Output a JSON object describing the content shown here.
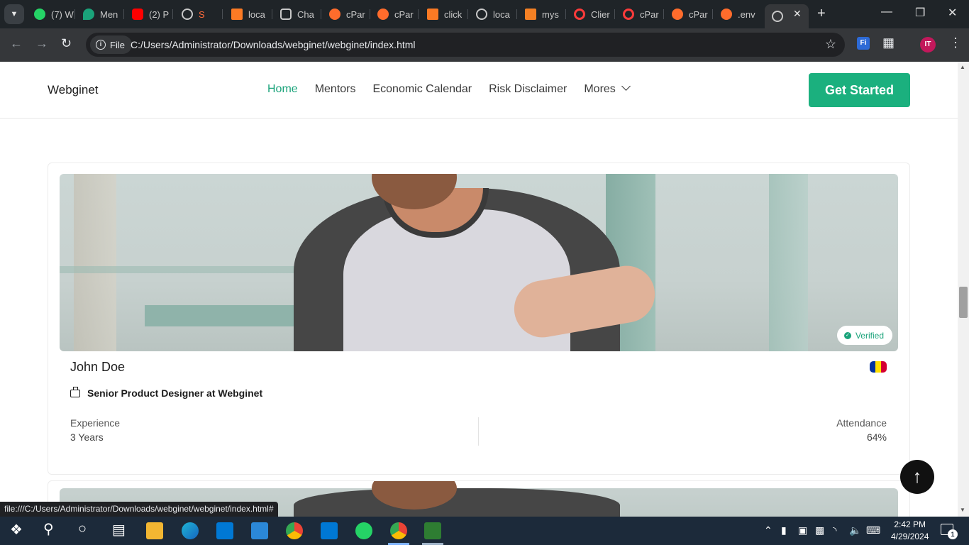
{
  "browser": {
    "tabs": [
      {
        "label": "(7) W",
        "icon": "whatsapp-icon",
        "color": "#25d366"
      },
      {
        "label": "Men",
        "icon": "map-pin-icon",
        "color": "#1aa37a"
      },
      {
        "label": "(2) P",
        "icon": "youtube-icon",
        "color": "#ff0000"
      },
      {
        "label": "S",
        "icon": "globe-icon",
        "color": "#c8c8c8"
      },
      {
        "label": "loca",
        "icon": "xampp-icon",
        "color": "#fb7a24"
      },
      {
        "label": "Cha",
        "icon": "chatgpt-icon",
        "color": "#c8c8c8"
      },
      {
        "label": "cPar",
        "icon": "cpanel-icon",
        "color": "#ff6c2c"
      },
      {
        "label": "cPar",
        "icon": "cpanel-icon",
        "color": "#ff6c2c"
      },
      {
        "label": "click",
        "icon": "xampp-icon",
        "color": "#fb7a24"
      },
      {
        "label": "loca",
        "icon": "globe-icon",
        "color": "#c8c8c8"
      },
      {
        "label": "mys",
        "icon": "stackoverflow-icon",
        "color": "#f48024"
      },
      {
        "label": "Clier",
        "icon": "opera-icon",
        "color": "#ff3b3b"
      },
      {
        "label": "cPar",
        "icon": "opera-icon",
        "color": "#ff3b3b"
      },
      {
        "label": "cPar",
        "icon": "cpanel-icon",
        "color": "#ff6c2c"
      },
      {
        "label": ".env",
        "icon": "cpanel-icon",
        "color": "#ff6c2c"
      }
    ],
    "active_tab_icon": "globe-icon",
    "address": {
      "chip_label": "File",
      "url": "C:/Users/Administrator/Downloads/webginet/webginet/index.html"
    },
    "profile_initials": "IT",
    "extension_label": "Fi",
    "status_url": "file:///C:/Users/Administrator/Downloads/webginet/webginet/index.html#"
  },
  "site": {
    "brand": "Webginet",
    "nav": [
      {
        "label": "Home",
        "active": true
      },
      {
        "label": "Mentors"
      },
      {
        "label": "Economic Calendar"
      },
      {
        "label": "Risk Disclaimer"
      },
      {
        "label": "Mores",
        "dropdown": true
      }
    ],
    "cta": "Get Started",
    "accent_color": "#1bb07e"
  },
  "mentor_card": {
    "name": "John Doe",
    "badge": "Verified",
    "role": "Senior Product Designer at Webginet",
    "experience_label": "Experience",
    "experience_value": "3 Years",
    "attendance_label": "Attendance",
    "attendance_value": "64%",
    "flag_colors": [
      "#0032a0",
      "#fedf00",
      "#d50032"
    ]
  },
  "taskbar": {
    "time": "2:42 PM",
    "date": "4/29/2024",
    "notification_count": "1"
  }
}
